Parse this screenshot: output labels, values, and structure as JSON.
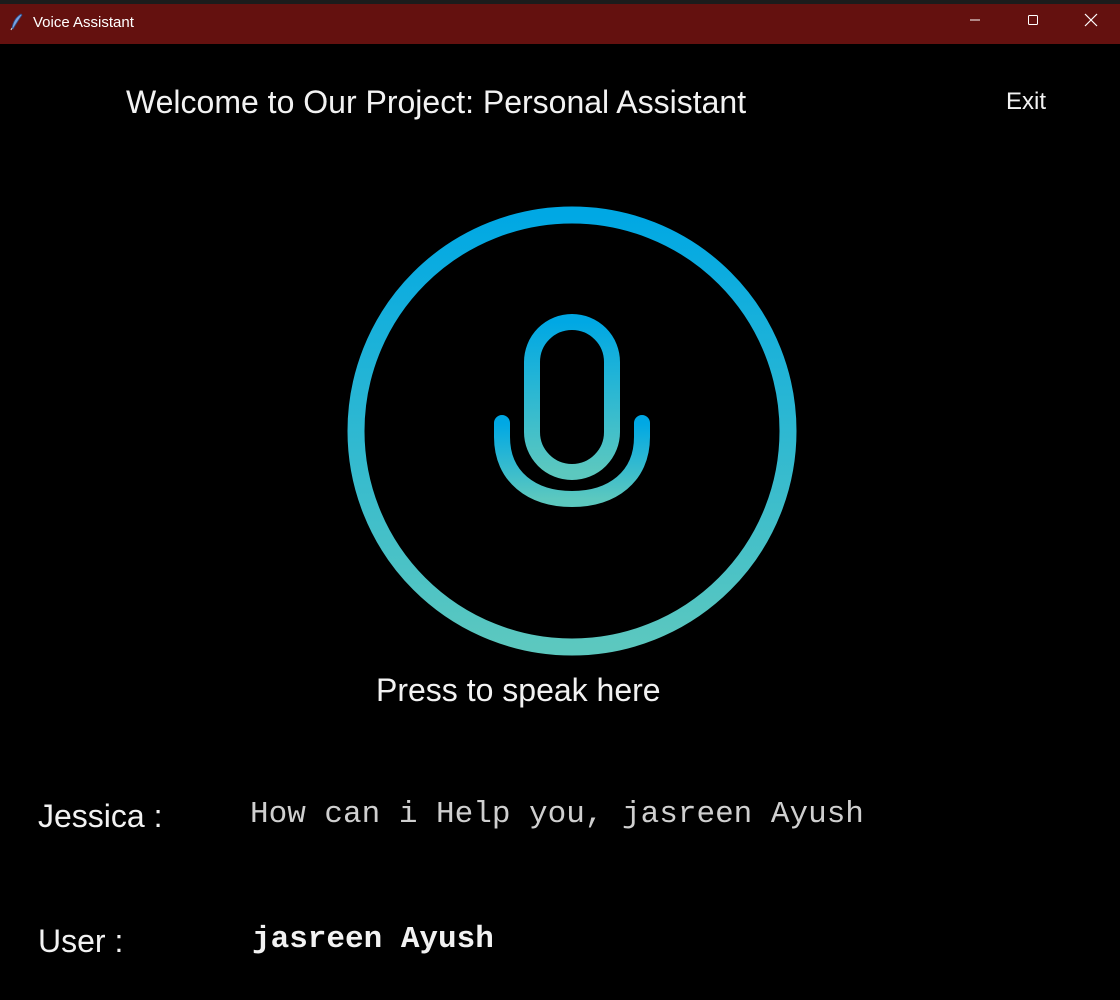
{
  "window": {
    "title": "Voice Assistant",
    "titlebar_color": "#64110f",
    "icons": {
      "app": "feather-pen-icon",
      "minimize": "minimize-icon",
      "maximize": "maximize-icon",
      "close": "close-icon"
    }
  },
  "header": {
    "title": "Welcome to Our Project: Personal Assistant",
    "exit_label": "Exit"
  },
  "mic": {
    "icon": "microphone-icon",
    "gradient_top": "#00a8e4",
    "gradient_bottom": "#5cc8bf",
    "prompt": "Press to speak here"
  },
  "conversation": {
    "assistant_label": "Jessica :",
    "assistant_message": "How can i Help you, jasreen Ayush",
    "user_label": "User :",
    "user_message": "jasreen Ayush"
  }
}
